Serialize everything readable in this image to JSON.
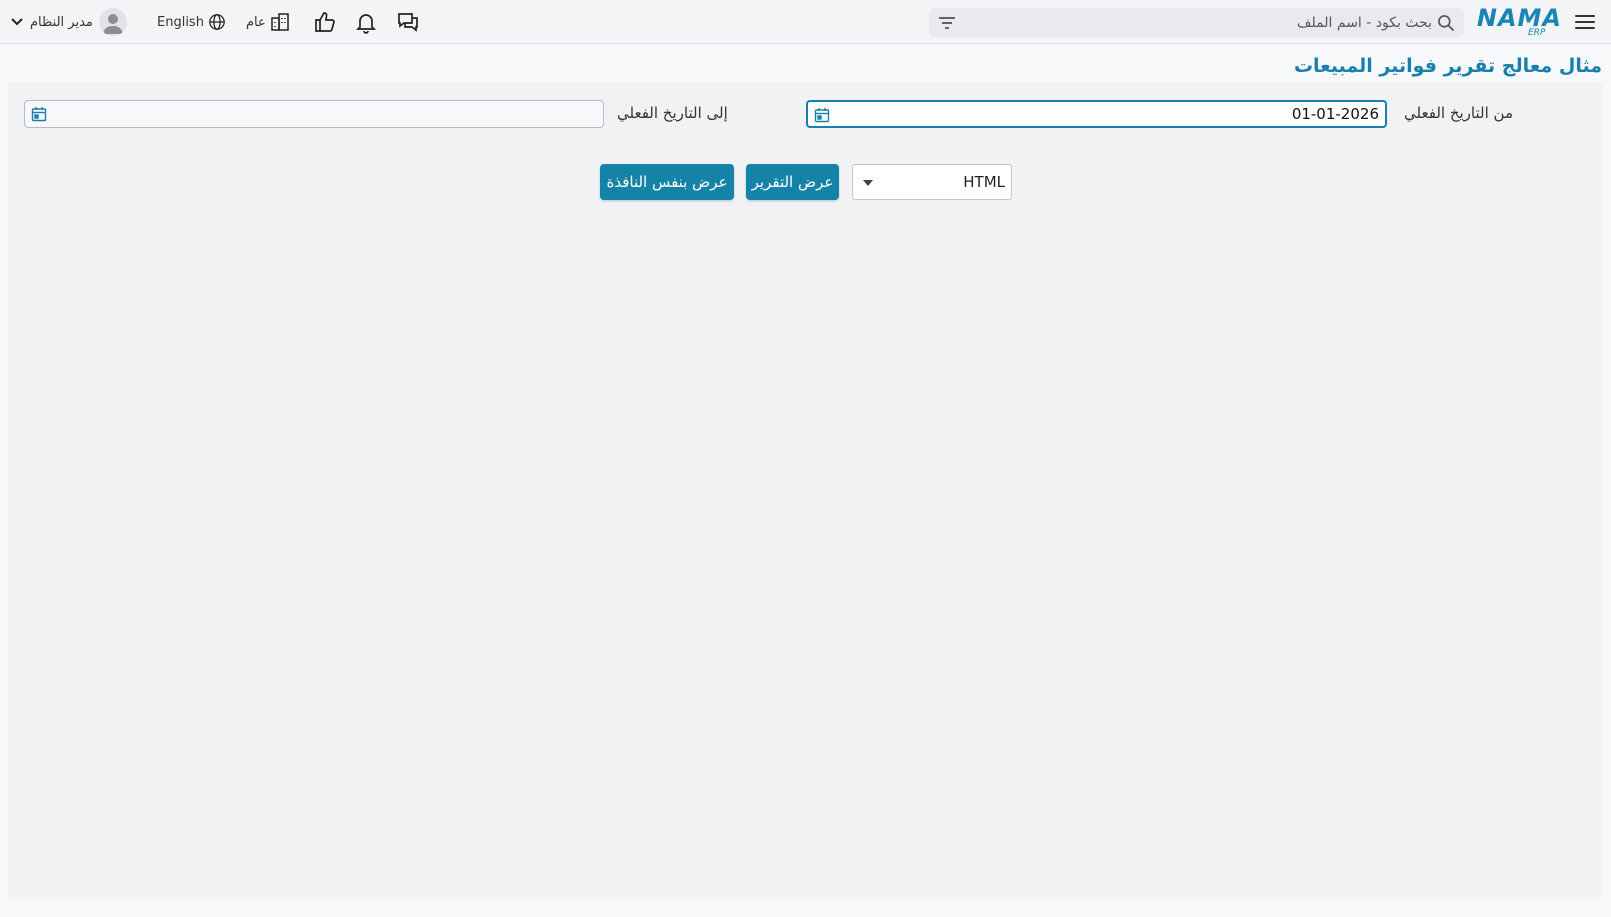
{
  "header": {
    "logo_text": "NAMA",
    "logo_sub": "ERP",
    "search_placeholder": "بحث بكود - اسم الملف",
    "branch_label": "عام",
    "language_label": "English",
    "user_name": "مدير النظام"
  },
  "page": {
    "title": "مثال معالج تقرير فواتير المبيعات"
  },
  "form": {
    "from_label": "من التاريخ الفعلي",
    "from_value": "01-01-2026",
    "to_label": "إلى التاريخ الفعلي",
    "to_value": "",
    "format_selected": "HTML",
    "show_report_label": "عرض التقرير",
    "show_same_window_label": "عرض بنفس النافذة"
  },
  "colors": {
    "accent": "#1a7fae",
    "button": "#1582a8"
  }
}
